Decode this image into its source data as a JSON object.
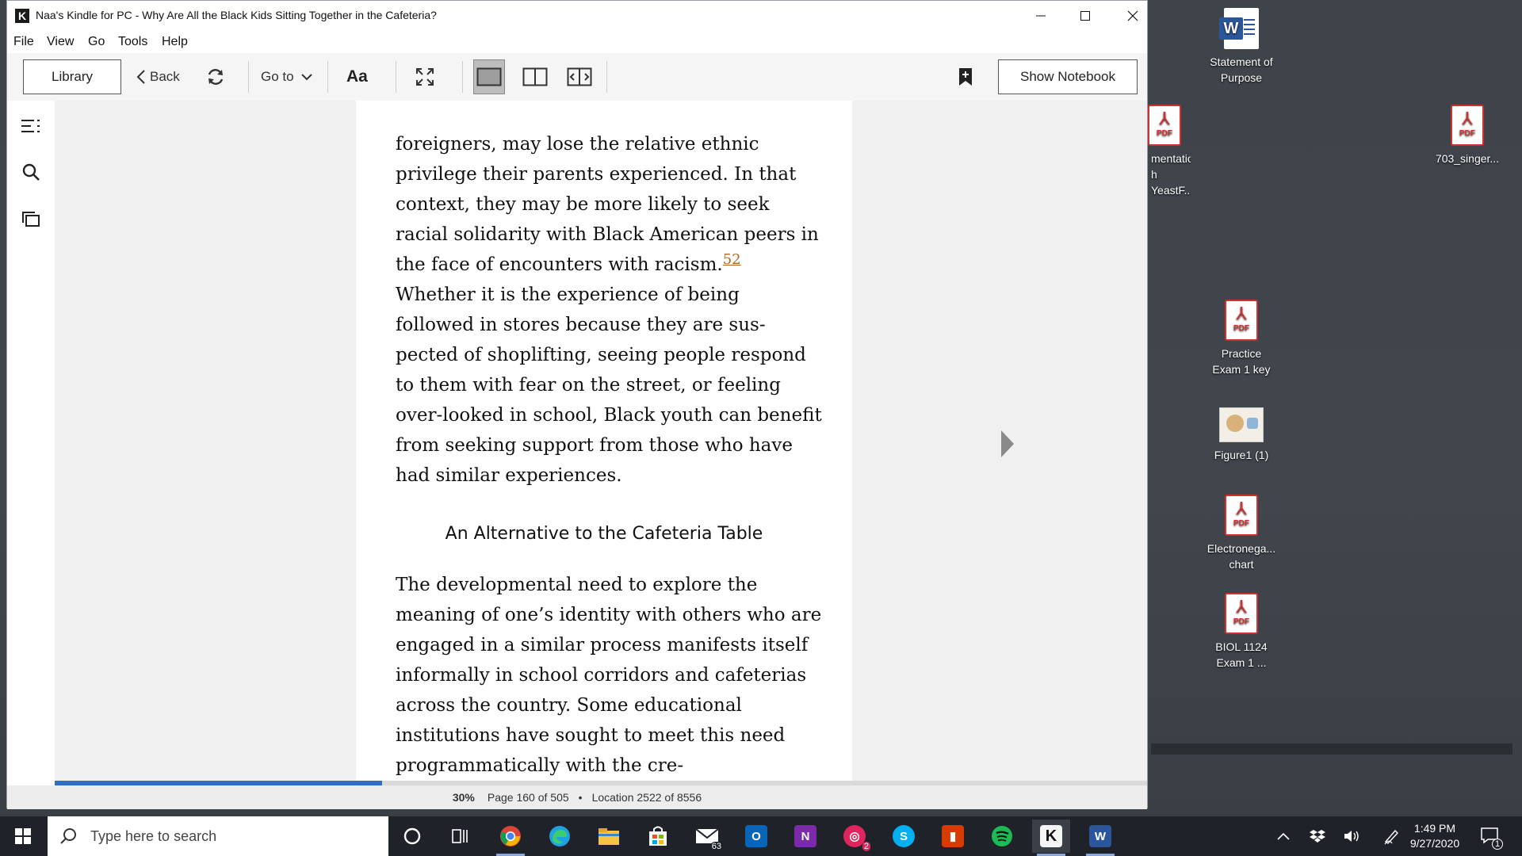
{
  "window": {
    "title": "Naa's Kindle for PC - Why Are All the Black Kids Sitting Together in the Cafeteria?",
    "app_icon_letter": "K"
  },
  "menu": [
    "File",
    "View",
    "Go",
    "Tools",
    "Help"
  ],
  "toolbar": {
    "library_label": "Library",
    "back_label": "Back",
    "goto_label": "Go to",
    "font_label": "Aa",
    "show_notebook_label": "Show Notebook"
  },
  "page": {
    "paragraph1": "foreigners, may lose the relative ethnic privilege their parents experienced. In that context, they may be more likely to seek racial solidarity with Black American peers in the face of encounters with racism.",
    "footnote": "52",
    "paragraph1_cont": " Whether it is the experience of being followed in stores because they are sus-pected of shoplifting, seeing people respond to them with fear on the street, or feeling over-looked in school, Black youth can benefit from seeking support from those who have had similar experiences.",
    "heading": "An Alternative to the Cafeteria Table",
    "paragraph2": "The developmental need to explore the meaning of one’s identity with others who are engaged in a similar process manifests itself informally in school corridors and cafeterias across the country. Some educational institutions have sought to meet this need programmatically with the cre-"
  },
  "status": {
    "percent": "30%",
    "page": "Page 160 of 505",
    "separator": "•",
    "location": "Location 2522 of 8556",
    "progress_fraction": 0.3
  },
  "desktop_icons": [
    {
      "label_1": "Statement of",
      "label_2": "Purpose",
      "type": "word"
    },
    {
      "label_1": "mentation",
      "label_2": "h YeastF...",
      "type": "pdf"
    },
    {
      "label_1": "703_singer...",
      "label_2": "",
      "type": "pdf"
    },
    {
      "label_1": "Practice",
      "label_2": "Exam 1 key",
      "type": "pdf"
    },
    {
      "label_1": "Figure1 (1)",
      "label_2": "",
      "type": "image"
    },
    {
      "label_1": "Electronega...",
      "label_2": "chart",
      "type": "pdf"
    },
    {
      "label_1": "BIOL 1124",
      "label_2": "Exam 1 ...",
      "type": "pdf"
    }
  ],
  "pdf_badge": "PDF",
  "taskbar": {
    "search_placeholder": "Type here to search",
    "mail_badge": "63",
    "app2_badge": "2",
    "time": "1:49 PM",
    "date": "9/27/2020",
    "notification_count": "1"
  },
  "colors": {
    "progress": "#2f6fbf",
    "footnote": "#b4651e",
    "taskbar": "#1f2229"
  }
}
